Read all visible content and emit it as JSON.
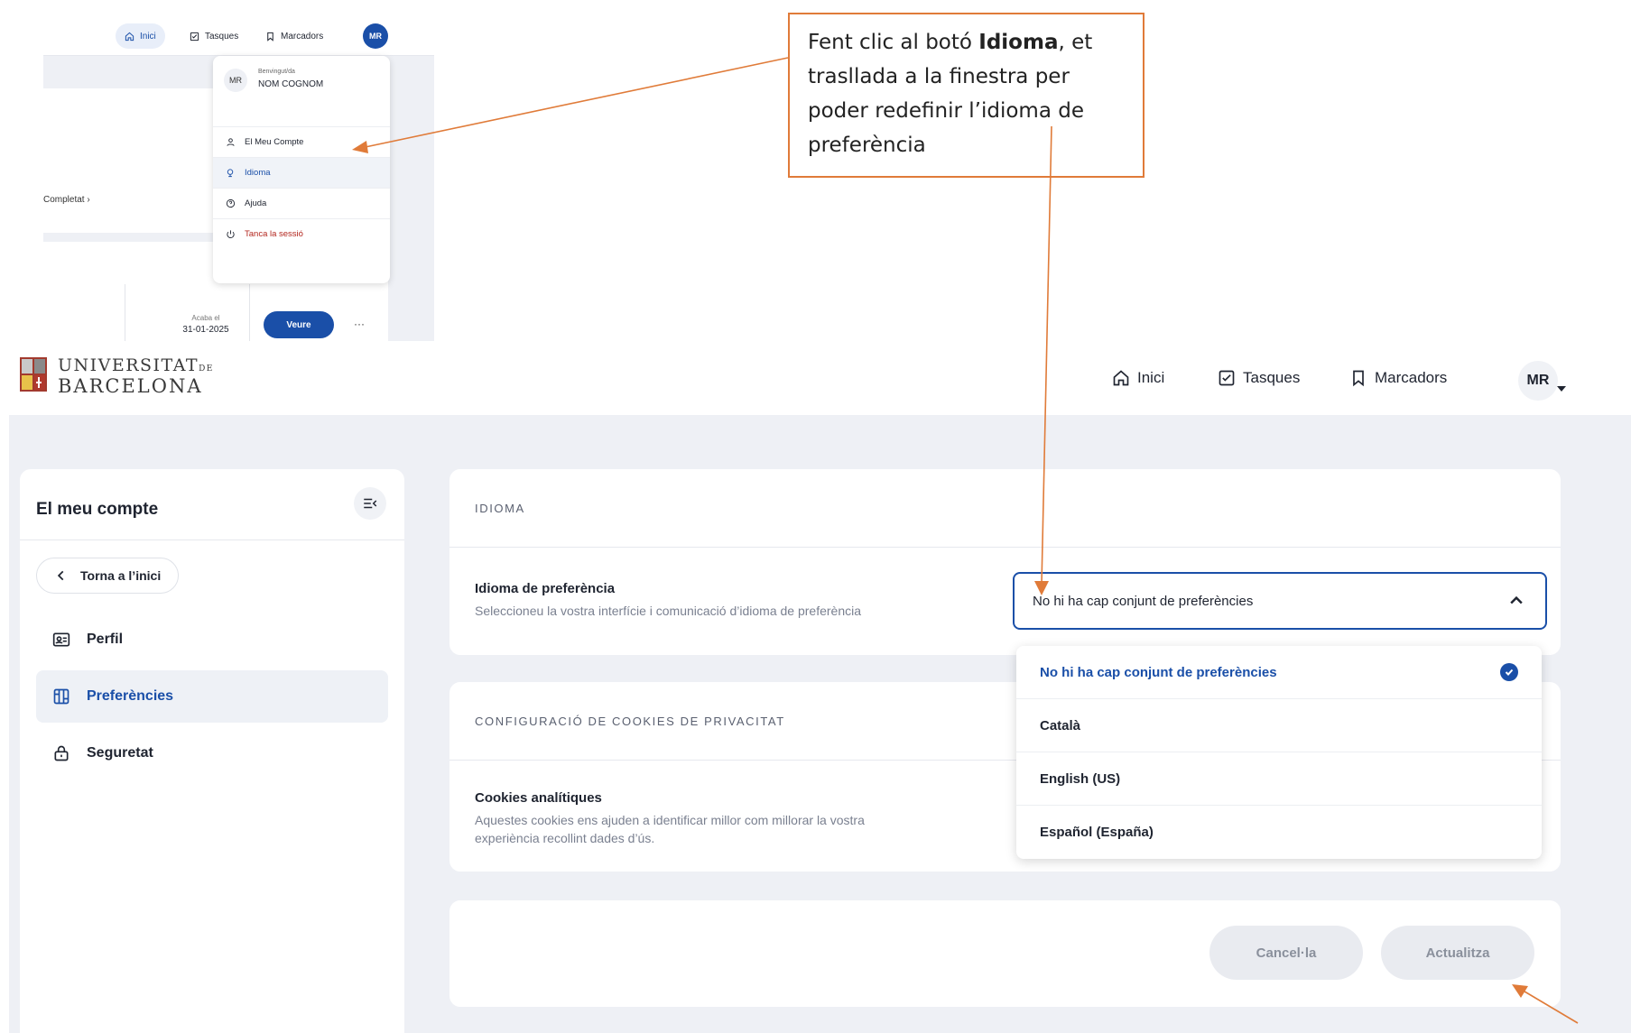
{
  "inset": {
    "nav": {
      "home": "Inici",
      "tasks": "Tasques",
      "bookmarks": "Marcadors"
    },
    "avatar": "MR",
    "menu": {
      "avatar": "MR",
      "welcome": "Benvingut/da",
      "name": "NOM COGNOM",
      "items": [
        {
          "label": "El Meu Compte",
          "icon": "user-icon"
        },
        {
          "label": "Idioma",
          "icon": "language-icon"
        },
        {
          "label": "Ajuda",
          "icon": "help-icon"
        },
        {
          "label": "Tanca la sessió",
          "icon": "power-icon"
        }
      ]
    },
    "completat": "Completat",
    "acaba_label": "Acaba el",
    "acaba_date": "31-01-2025",
    "veure": "Veure",
    "more": "···"
  },
  "annotation": {
    "prefix": "Fent clic al botó ",
    "bold": "Idioma",
    "suffix": ", et trasllada a la finestra per poder redefinir l’idioma de preferència"
  },
  "header": {
    "logo_line1": "UNIVERSITAT",
    "logo_de": "DE",
    "logo_line2": "BARCELONA",
    "nav": {
      "home": "Inici",
      "tasks": "Tasques",
      "bookmarks": "Marcadors"
    },
    "avatar": "MR"
  },
  "sidebar": {
    "title": "El meu compte",
    "back": "Torna a l’inici",
    "items": [
      {
        "label": "Perfil",
        "icon": "profile-card-icon"
      },
      {
        "label": "Preferències",
        "icon": "preferences-grid-icon",
        "active": true
      },
      {
        "label": "Seguretat",
        "icon": "lock-icon"
      }
    ]
  },
  "language_card": {
    "heading": "IDIOMA",
    "field_label": "Idioma de preferència",
    "field_help": "Seleccioneu la vostra interfície i comunicació d’idioma de preferència",
    "selected_value": "No hi ha cap conjunt de preferències",
    "options": [
      "No hi ha cap conjunt de preferències",
      "Català",
      "English (US)",
      "Español (España)"
    ]
  },
  "cookies_card": {
    "heading": "CONFIGURACIÓ DE COOKIES DE PRIVACITAT",
    "field_label": "Cookies analítiques",
    "field_help_line1": "Aquestes cookies ens ajuden a identificar millor com millorar la vostra",
    "field_help_line2": "experiència recollint dades d’ús."
  },
  "actions": {
    "cancel": "Cancel·la",
    "update": "Actualitza"
  },
  "colors": {
    "accent": "#1a4fa8",
    "annotation": "#e07b39",
    "background": "#eef0f5"
  }
}
